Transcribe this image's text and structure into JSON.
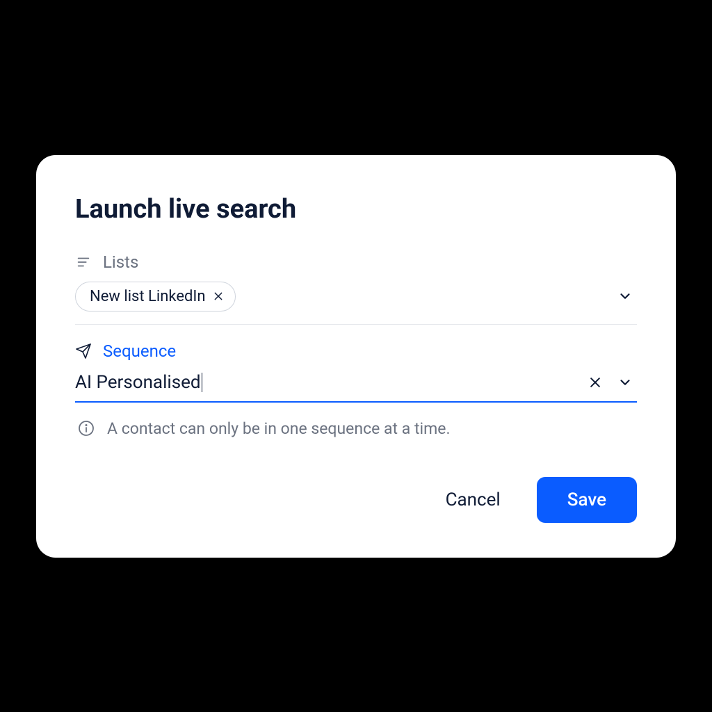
{
  "dialog": {
    "title": "Launch live search"
  },
  "lists": {
    "label": "Lists",
    "chip": "New list LinkedIn"
  },
  "sequence": {
    "label": "Sequence",
    "value": "AI Personalised"
  },
  "info": {
    "text": "A contact can only be in one sequence at a time."
  },
  "actions": {
    "cancel": "Cancel",
    "save": "Save"
  },
  "colors": {
    "accent": "#0a5cff",
    "text": "#0f1b35",
    "muted": "#6b7280"
  }
}
